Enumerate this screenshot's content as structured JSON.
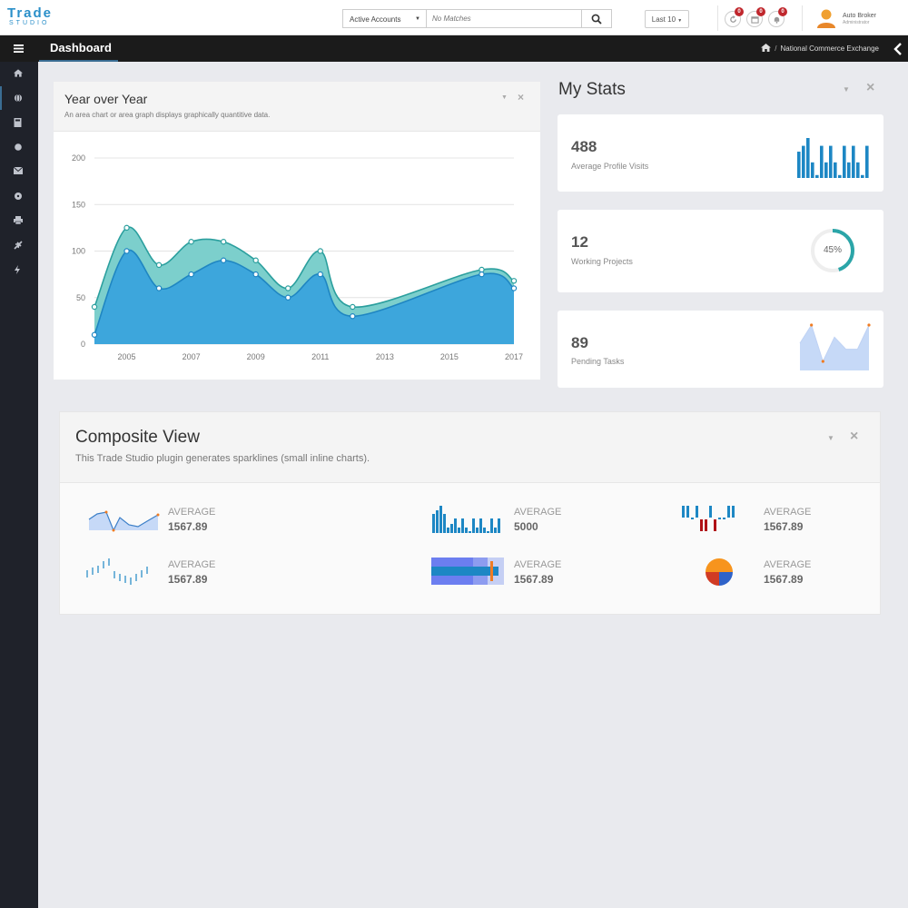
{
  "header": {
    "logo_top": "Trade",
    "logo_bottom": "STUDIO",
    "account_select": "Active Accounts",
    "search_placeholder": "No Matches",
    "last_filter": "Last 10",
    "notifications": [
      {
        "icon": "refresh-icon",
        "count": "0"
      },
      {
        "icon": "calendar-icon",
        "count": "0"
      },
      {
        "icon": "bell-icon",
        "count": "0"
      }
    ],
    "user_name": "Auto Broker",
    "user_role": "Administrator"
  },
  "navbar": {
    "title": "Dashboard",
    "breadcrumb": "National Commerce Exchange"
  },
  "sidebar": {
    "items": [
      "home-icon",
      "globe-icon",
      "calculator-icon",
      "circle-icon",
      "envelope-icon",
      "compass-icon",
      "print-icon",
      "plane-icon",
      "bolt-icon"
    ]
  },
  "year_over_year": {
    "title": "Year over Year",
    "subtitle": "An area chart or area graph displays graphically quantitive data."
  },
  "my_stats": {
    "title": "My Stats",
    "cards": [
      {
        "value": "488",
        "label": "Average Profile Visits",
        "bars": [
          27,
          33,
          41,
          16,
          3,
          33,
          16,
          33,
          16,
          3,
          33,
          16,
          33,
          16,
          3,
          33
        ]
      },
      {
        "value": "12",
        "label": "Working Projects",
        "percent_text": "45%",
        "percent": 0.45
      },
      {
        "value": "89",
        "label": "Pending Tasks",
        "line": [
          5,
          8,
          2,
          6,
          4,
          4,
          8
        ]
      }
    ]
  },
  "composite": {
    "title": "Composite View",
    "subtitle": "This Trade Studio plugin generates sparklines (small inline charts).",
    "items": [
      {
        "label": "AVERAGE",
        "value": "1567.89"
      },
      {
        "label": "AVERAGE",
        "value": "5000"
      },
      {
        "label": "AVERAGE",
        "value": "1567.89"
      },
      {
        "label": "AVERAGE",
        "value": "1567.89"
      },
      {
        "label": "AVERAGE",
        "value": "1567.89"
      },
      {
        "label": "AVERAGE",
        "value": "1567.89"
      }
    ]
  },
  "colors": {
    "accent": "#2a8fc9",
    "area_front": "#3da6dc",
    "area_back": "#7ccfcc",
    "line_back": "#2b9f9e",
    "bar": "#1d87c4",
    "sidebar": "#1f222a",
    "badge": "#c0272d"
  },
  "chart_data": {
    "type": "area",
    "x": [
      2004,
      2005,
      2006,
      2007,
      2008,
      2009,
      2010,
      2011,
      2012,
      2013,
      2014,
      2015,
      2016,
      2017
    ],
    "x_ticks": [
      "2005",
      "2007",
      "2009",
      "2011",
      "2013",
      "2015",
      "2017"
    ],
    "y_ticks": [
      "0",
      "50",
      "100",
      "150",
      "200"
    ],
    "ylim": [
      0,
      200
    ],
    "xlim": [
      2004,
      2017
    ],
    "grid": true,
    "series": [
      {
        "x": [
          2004,
          2005,
          2006,
          2007,
          2008,
          2009,
          2010,
          2011,
          2012,
          2016,
          2017
        ],
        "values": [
          40,
          125,
          85,
          110,
          110,
          90,
          60,
          100,
          40,
          80,
          68
        ]
      },
      {
        "x": [
          2004,
          2005,
          2006,
          2007,
          2008,
          2009,
          2010,
          2011,
          2012,
          2016,
          2017
        ],
        "values": [
          10,
          100,
          60,
          75,
          90,
          75,
          50,
          75,
          30,
          75,
          60
        ]
      }
    ]
  }
}
